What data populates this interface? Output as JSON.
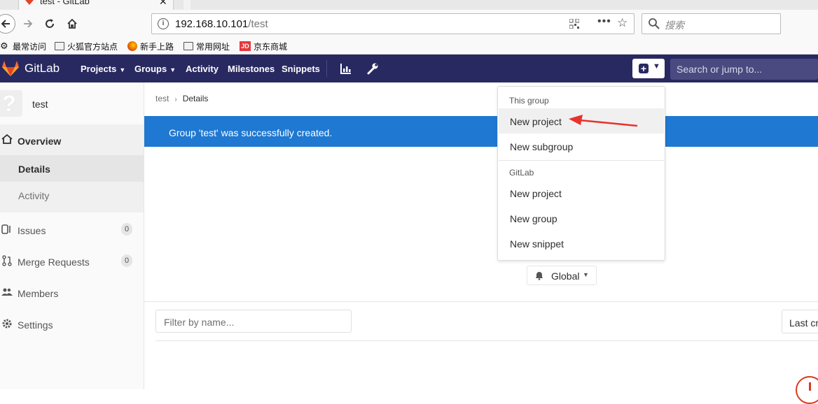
{
  "browser": {
    "tab_title": "test - GitLab",
    "url_host": "192.168.10.101",
    "url_path": "/test",
    "search_placeholder": "搜索",
    "bookmarks": [
      {
        "label": "最常访问",
        "icon": "gear-icon"
      },
      {
        "label": "火狐官方站点",
        "icon": "folder-icon"
      },
      {
        "label": "新手上路",
        "icon": "firefox-icon"
      },
      {
        "label": "常用网址",
        "icon": "folder-icon"
      },
      {
        "label": "京东商城",
        "icon": "jd-icon"
      }
    ]
  },
  "header": {
    "brand": "GitLab",
    "nav": [
      {
        "label": "Projects",
        "dropdown": true
      },
      {
        "label": "Groups",
        "dropdown": true
      },
      {
        "label": "Activity",
        "dropdown": false
      },
      {
        "label": "Milestones",
        "dropdown": false
      },
      {
        "label": "Snippets",
        "dropdown": false
      }
    ],
    "search_placeholder": "Search or jump to...",
    "colors": {
      "header_bg": "#292961",
      "flash_bg": "#1f78d1",
      "accent": "#db3b21"
    }
  },
  "sidebar": {
    "group_name": "test",
    "avatar_glyph": "?",
    "overview": "Overview",
    "sub_items": [
      "Details",
      "Activity"
    ],
    "items": [
      {
        "label": "Issues",
        "count": "0",
        "icon": "issues-icon"
      },
      {
        "label": "Merge Requests",
        "count": "0",
        "icon": "merge-request-icon"
      },
      {
        "label": "Members",
        "count": null,
        "icon": "members-icon"
      },
      {
        "label": "Settings",
        "count": null,
        "icon": "settings-icon"
      }
    ]
  },
  "main": {
    "breadcrumb": [
      "test",
      "Details"
    ],
    "flash_message": "Group 'test' was successfully created.",
    "notification_level": "Global",
    "filter_placeholder": "Filter by name...",
    "sort_label": "Last created"
  },
  "dropdown": {
    "this_group_header": "This group",
    "this_group_items": [
      "New project",
      "New subgroup"
    ],
    "gitlab_header": "GitLab",
    "gitlab_items": [
      "New project",
      "New group",
      "New snippet"
    ]
  }
}
